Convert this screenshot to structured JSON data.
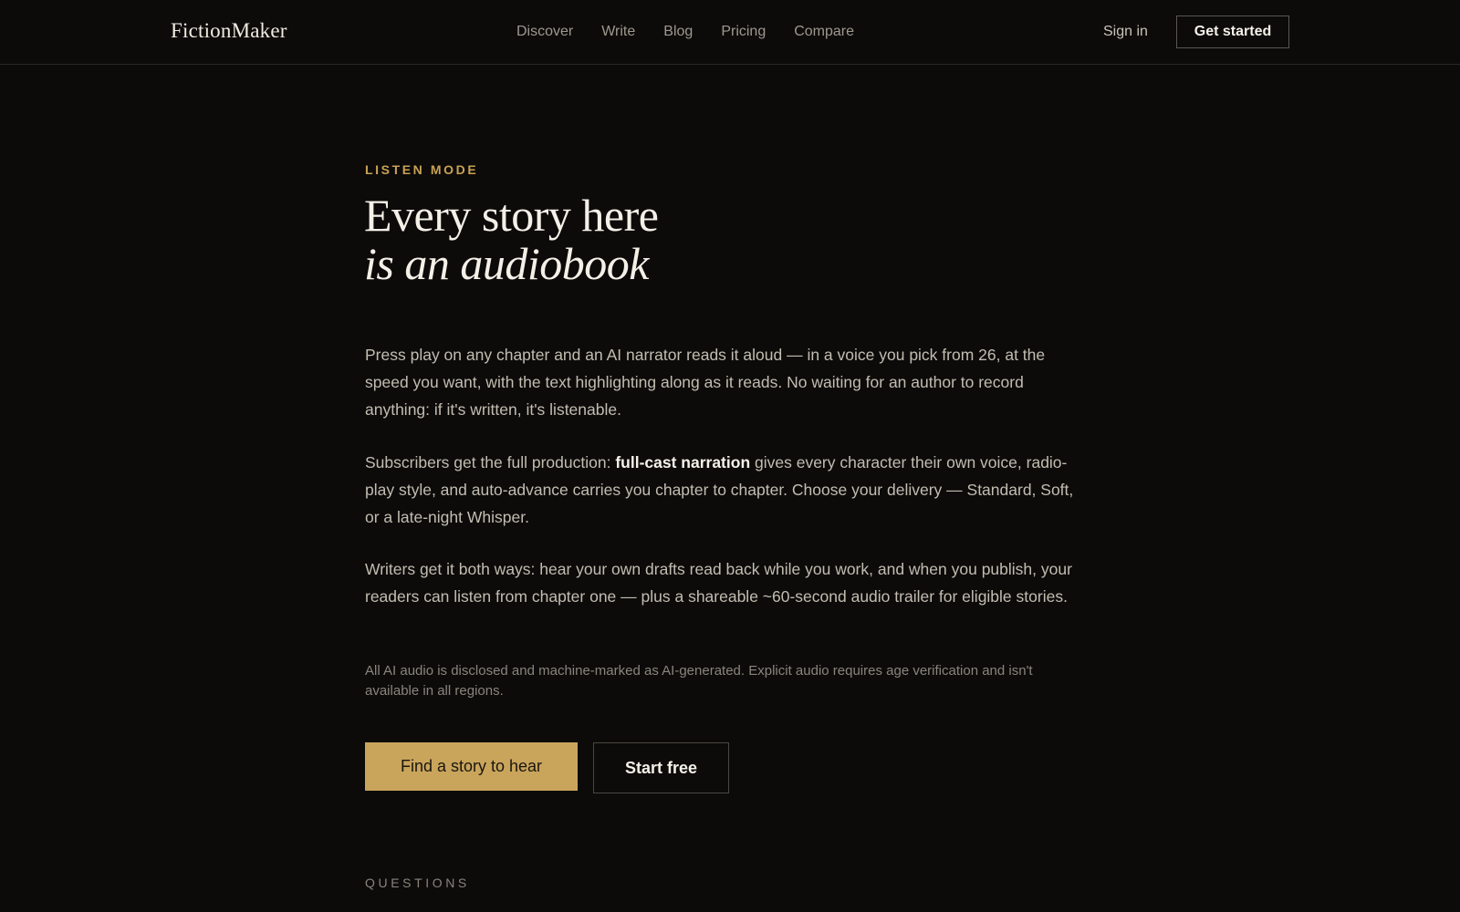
{
  "nav": {
    "logo": "FictionMaker",
    "links": [
      "Discover",
      "Write",
      "Blog",
      "Pricing",
      "Compare"
    ],
    "sign_in": "Sign in",
    "get_started": "Get started"
  },
  "hero": {
    "eyebrow": "LISTEN MODE",
    "headline_line1": "Every story here",
    "headline_line2": "is an audiobook",
    "p1": "Press play on any chapter and an AI narrator reads it aloud — in a voice you pick from 26, at the speed you want, with the text highlighting along as it reads. No waiting for an author to record anything: if it's written, it's listenable.",
    "p2_before": "Subscribers get the full production: ",
    "p2_bold": "full-cast narration",
    "p2_after": " gives every character their own voice, radio-play style, and auto-advance carries you chapter to chapter. Choose your delivery — Standard, Soft, or a late-night Whisper.",
    "p3": "Writers get it both ways: hear your own drafts read back while you work, and when you publish, your readers can listen from chapter one — plus a shareable ~60-second audio trailer for eligible stories.",
    "disclaimer": "All AI audio is disclosed and machine-marked as AI-generated. Explicit audio requires age verification and isn't available in all regions.",
    "cta_primary": "Find a story to hear",
    "cta_secondary": "Start free"
  },
  "questions": {
    "label": "QUESTIONS"
  },
  "colors": {
    "background": "#0c0b0a",
    "accent": "#c9a55c",
    "eyebrow": "#c9a155"
  }
}
